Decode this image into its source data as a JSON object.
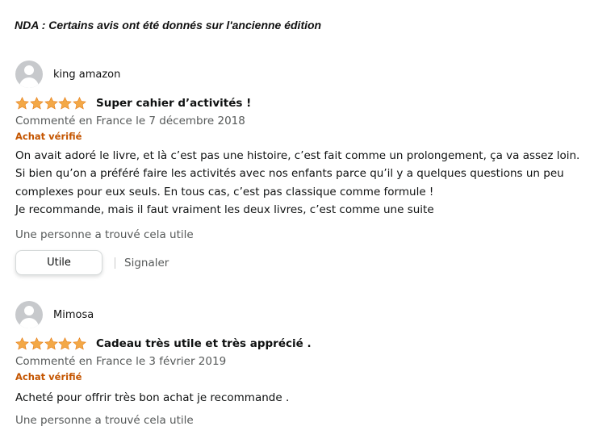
{
  "notice": "NDA :  Certains avis ont été donnés sur l'ancienne édition",
  "colors": {
    "star": "#f3a847",
    "verified": "#c45500",
    "muted": "#565959",
    "text": "#0f1111"
  },
  "reviews": [
    {
      "reviewer": "king amazon",
      "rating": 5,
      "title": "Super cahier d’activités !",
      "date": "Commenté en France le 7 décembre 2018",
      "verified": "Achat vérifié",
      "body": [
        "On avait adoré le livre, et là c’est pas une histoire, c’est fait comme un prolongement, ça va assez loin.",
        "Si bien qu’on a préféré faire les activités avec nos enfants parce qu’il y a quelques questions un peu",
        "complexes pour eux seuls. En tous cas, c’est pas classique comme formule !",
        "Je recommande, mais il faut vraiment les deux livres, c’est comme une suite"
      ],
      "helpful_count": "Une personne a trouvé cela utile",
      "helpful_button": "Utile",
      "report_label": "Signaler"
    },
    {
      "reviewer": "Mimosa",
      "rating": 5,
      "title": "Cadeau très utile et très apprécié .",
      "date": "Commenté en France le 3 février 2019",
      "verified": "Achat vérifié",
      "body": [
        "Acheté pour offrir très bon achat je recommande ."
      ],
      "helpful_count": "Une personne a trouvé cela utile"
    }
  ]
}
